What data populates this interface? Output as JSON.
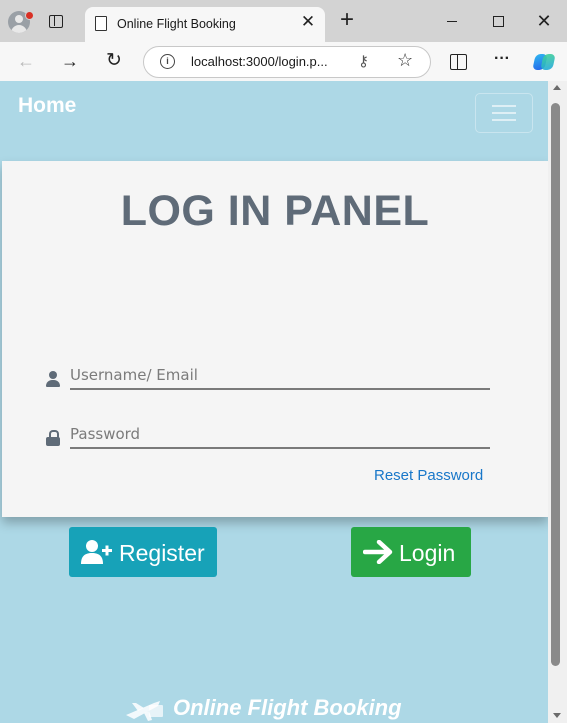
{
  "browser": {
    "tab_title": "Online Flight Booking",
    "tab_close": "✕",
    "new_tab": "+",
    "url": "localhost:3000/login.p...",
    "more": "···",
    "window_close": "✕"
  },
  "navbar": {
    "brand": "Home"
  },
  "login_panel": {
    "title": "LOG IN PANEL",
    "username_placeholder": "Username/ Email",
    "password_placeholder": "Password",
    "reset_link": "Reset Password",
    "register_label": "Register",
    "login_label": "Login"
  },
  "footer": {
    "brand": "Online Flight Booking"
  },
  "colors": {
    "page_background": "#add8e6",
    "panel_background": "#f5f5f5",
    "title_color": "#5f6b78",
    "register_button": "#17a2b8",
    "login_button": "#28a745",
    "link": "#1877c9"
  }
}
